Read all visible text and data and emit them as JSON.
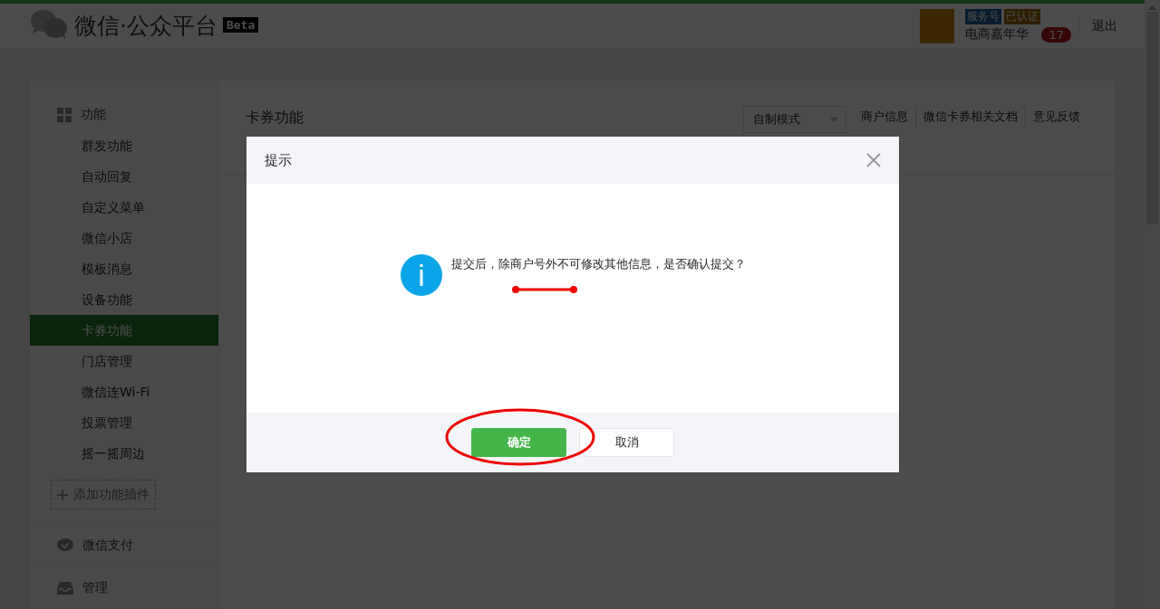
{
  "header": {
    "logo_text": "微信·公众平台",
    "beta": "Beta",
    "account_type": "服务号",
    "verified": "已认证",
    "account_name": "电商嘉年华",
    "notification_count": "17",
    "logout": "退出"
  },
  "sidebar": {
    "sections": [
      {
        "title": "功能",
        "items": [
          {
            "label": "群发功能",
            "selected": false
          },
          {
            "label": "自动回复",
            "selected": false
          },
          {
            "label": "自定义菜单",
            "selected": false
          },
          {
            "label": "微信小店",
            "selected": false
          },
          {
            "label": "模板消息",
            "selected": false
          },
          {
            "label": "设备功能",
            "selected": false
          },
          {
            "label": "卡券功能",
            "selected": true
          },
          {
            "label": "门店管理",
            "selected": false
          },
          {
            "label": "微信连Wi-Fi",
            "selected": false
          },
          {
            "label": "投票管理",
            "selected": false
          },
          {
            "label": "摇一摇周边",
            "selected": false
          }
        ],
        "add_button": "添加功能插件"
      },
      {
        "title": "微信支付"
      },
      {
        "title": "管理"
      }
    ]
  },
  "main": {
    "title": "卡券功能",
    "mode_select": "自制模式",
    "links": [
      "商户信息",
      "微信卡券相关文档",
      "意见反馈"
    ]
  },
  "dialog": {
    "title": "提示",
    "message": "提交后，除商户号外不可修改其他信息，是否确认提交？",
    "buttons": [
      {
        "label": "确定",
        "kind": "primary"
      },
      {
        "label": "取消",
        "kind": "default"
      }
    ]
  }
}
